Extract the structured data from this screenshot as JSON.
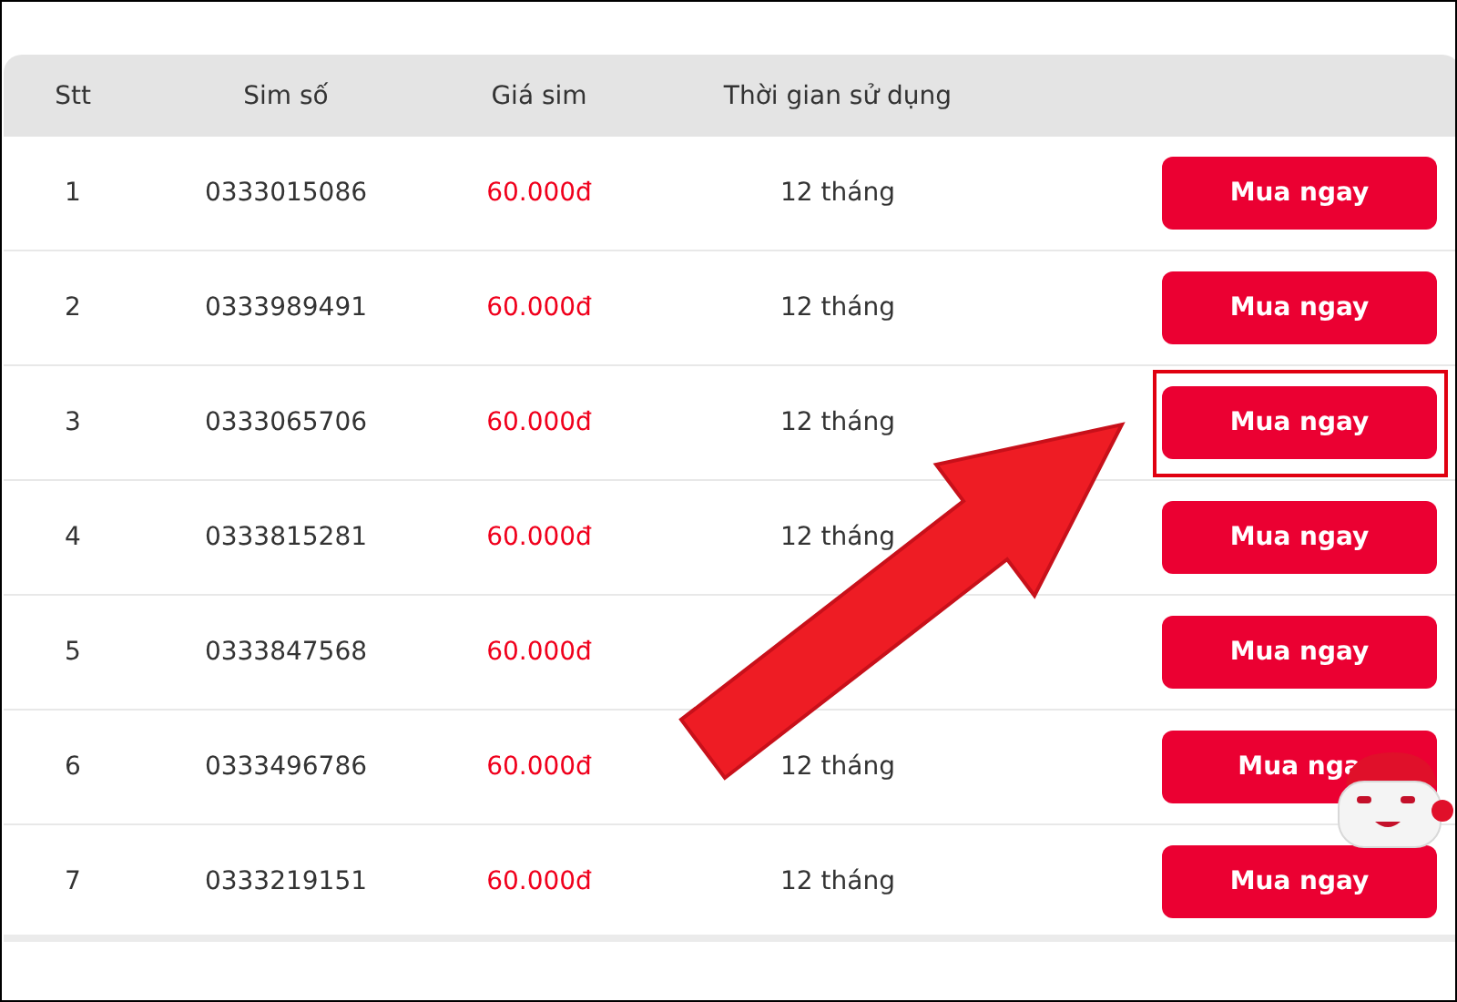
{
  "table": {
    "columns": [
      "Stt",
      "Sim số",
      "Giá sim",
      "Thời gian sử dụng"
    ],
    "rows": [
      {
        "stt": "1",
        "number": "0333015086",
        "price": "60.000đ",
        "duration": "12 tháng",
        "button": "Mua ngay",
        "highlighted": false
      },
      {
        "stt": "2",
        "number": "0333989491",
        "price": "60.000đ",
        "duration": "12 tháng",
        "button": "Mua ngay",
        "highlighted": false
      },
      {
        "stt": "3",
        "number": "0333065706",
        "price": "60.000đ",
        "duration": "12 tháng",
        "button": "Mua ngay",
        "highlighted": true
      },
      {
        "stt": "4",
        "number": "0333815281",
        "price": "60.000đ",
        "duration": "12 tháng",
        "button": "Mua ngay",
        "highlighted": false
      },
      {
        "stt": "5",
        "number": "0333847568",
        "price": "60.000đ",
        "button": "Mua ngay",
        "highlighted": false
      },
      {
        "stt": "6",
        "number": "0333496786",
        "price": "60.000đ",
        "duration": "12 tháng",
        "button": "Mua nga",
        "highlighted": false
      },
      {
        "stt": "7",
        "number": "0333219151",
        "price": "60.000đ",
        "duration": "12 tháng",
        "button": "Mua ngay",
        "highlighted": false
      }
    ]
  }
}
